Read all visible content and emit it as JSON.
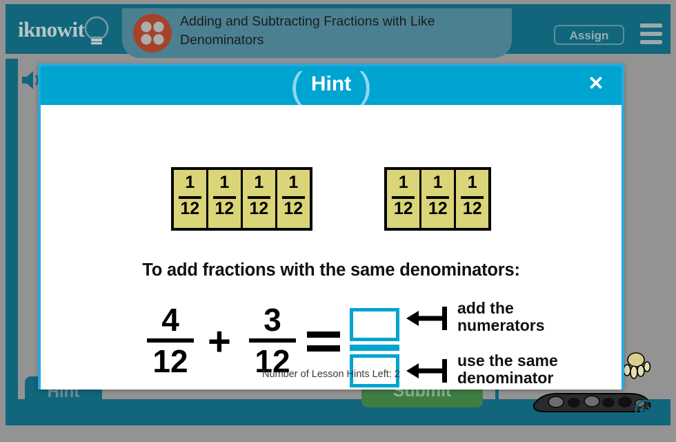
{
  "header": {
    "logo_text": "iknowit",
    "logo_icon": "lightbulb-icon",
    "subject_icon": "four-dot-circle-icon",
    "title": "Adding and Subtracting Fractions with Like Denominators",
    "assign_label": "Assign",
    "menu_icon": "hamburger-menu-icon",
    "bar_color": "#11667c",
    "plate_color": "#4b8091",
    "subject_icon_color": "#a4432a"
  },
  "stage": {
    "speaker_icon": "speaker-audio-icon",
    "background_color": "#939393",
    "frame_color": "#11667c",
    "hint_button_label": "Hint",
    "submit_button_label": "Submit",
    "submit_button_color": "#3f7d43",
    "paw_icon": "paw-graphic-icon",
    "tread_icon": "tank-tread-graphic-icon",
    "resize_icon": "resize-horizontal-icon"
  },
  "modal": {
    "title": "Hint",
    "close_label": "✕",
    "title_bar_color": "#00a4d1",
    "border_color": "#29a8dc",
    "instruction": "To add fractions with the same denominators:",
    "hints_left_text": "Number of Lesson Hints Left: 2",
    "tile_color": "#d9d578",
    "tile_groups": [
      {
        "count": 4,
        "numerator": "1",
        "denominator": "12"
      },
      {
        "count": 3,
        "numerator": "1",
        "denominator": "12"
      }
    ],
    "equation": {
      "left_fraction": {
        "numerator": "4",
        "denominator": "12"
      },
      "operator": "+",
      "right_fraction": {
        "numerator": "3",
        "denominator": "12"
      },
      "equals": "=",
      "answer_numerator": "",
      "answer_denominator": "",
      "answer_box_color": "#00a4d1",
      "note_top_line1": "add the",
      "note_top_line2": "numerators",
      "note_bottom_line1": "use the same",
      "note_bottom_line2": "denominator"
    }
  }
}
